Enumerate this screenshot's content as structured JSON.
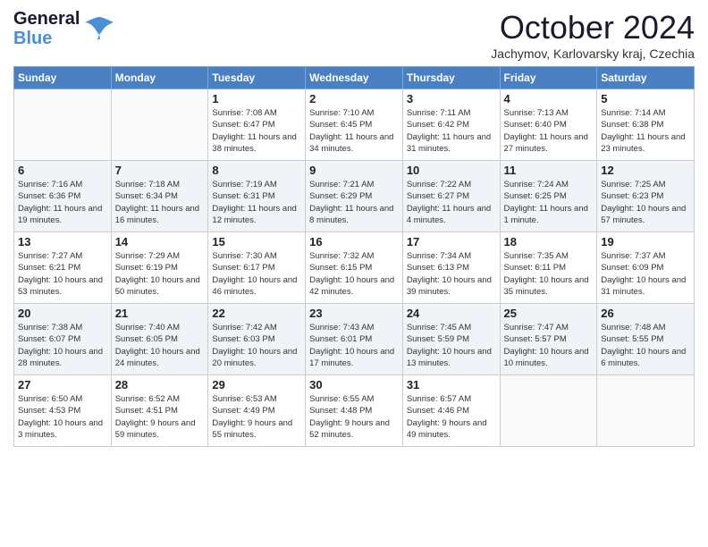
{
  "header": {
    "logo_line1": "General",
    "logo_line2": "Blue",
    "month": "October 2024",
    "location": "Jachymov, Karlovarsky kraj, Czechia"
  },
  "weekdays": [
    "Sunday",
    "Monday",
    "Tuesday",
    "Wednesday",
    "Thursday",
    "Friday",
    "Saturday"
  ],
  "weeks": [
    [
      {
        "day": "",
        "info": ""
      },
      {
        "day": "",
        "info": ""
      },
      {
        "day": "1",
        "info": "Sunrise: 7:08 AM\nSunset: 6:47 PM\nDaylight: 11 hours and 38 minutes."
      },
      {
        "day": "2",
        "info": "Sunrise: 7:10 AM\nSunset: 6:45 PM\nDaylight: 11 hours and 34 minutes."
      },
      {
        "day": "3",
        "info": "Sunrise: 7:11 AM\nSunset: 6:42 PM\nDaylight: 11 hours and 31 minutes."
      },
      {
        "day": "4",
        "info": "Sunrise: 7:13 AM\nSunset: 6:40 PM\nDaylight: 11 hours and 27 minutes."
      },
      {
        "day": "5",
        "info": "Sunrise: 7:14 AM\nSunset: 6:38 PM\nDaylight: 11 hours and 23 minutes."
      }
    ],
    [
      {
        "day": "6",
        "info": "Sunrise: 7:16 AM\nSunset: 6:36 PM\nDaylight: 11 hours and 19 minutes."
      },
      {
        "day": "7",
        "info": "Sunrise: 7:18 AM\nSunset: 6:34 PM\nDaylight: 11 hours and 16 minutes."
      },
      {
        "day": "8",
        "info": "Sunrise: 7:19 AM\nSunset: 6:31 PM\nDaylight: 11 hours and 12 minutes."
      },
      {
        "day": "9",
        "info": "Sunrise: 7:21 AM\nSunset: 6:29 PM\nDaylight: 11 hours and 8 minutes."
      },
      {
        "day": "10",
        "info": "Sunrise: 7:22 AM\nSunset: 6:27 PM\nDaylight: 11 hours and 4 minutes."
      },
      {
        "day": "11",
        "info": "Sunrise: 7:24 AM\nSunset: 6:25 PM\nDaylight: 11 hours and 1 minute."
      },
      {
        "day": "12",
        "info": "Sunrise: 7:25 AM\nSunset: 6:23 PM\nDaylight: 10 hours and 57 minutes."
      }
    ],
    [
      {
        "day": "13",
        "info": "Sunrise: 7:27 AM\nSunset: 6:21 PM\nDaylight: 10 hours and 53 minutes."
      },
      {
        "day": "14",
        "info": "Sunrise: 7:29 AM\nSunset: 6:19 PM\nDaylight: 10 hours and 50 minutes."
      },
      {
        "day": "15",
        "info": "Sunrise: 7:30 AM\nSunset: 6:17 PM\nDaylight: 10 hours and 46 minutes."
      },
      {
        "day": "16",
        "info": "Sunrise: 7:32 AM\nSunset: 6:15 PM\nDaylight: 10 hours and 42 minutes."
      },
      {
        "day": "17",
        "info": "Sunrise: 7:34 AM\nSunset: 6:13 PM\nDaylight: 10 hours and 39 minutes."
      },
      {
        "day": "18",
        "info": "Sunrise: 7:35 AM\nSunset: 6:11 PM\nDaylight: 10 hours and 35 minutes."
      },
      {
        "day": "19",
        "info": "Sunrise: 7:37 AM\nSunset: 6:09 PM\nDaylight: 10 hours and 31 minutes."
      }
    ],
    [
      {
        "day": "20",
        "info": "Sunrise: 7:38 AM\nSunset: 6:07 PM\nDaylight: 10 hours and 28 minutes."
      },
      {
        "day": "21",
        "info": "Sunrise: 7:40 AM\nSunset: 6:05 PM\nDaylight: 10 hours and 24 minutes."
      },
      {
        "day": "22",
        "info": "Sunrise: 7:42 AM\nSunset: 6:03 PM\nDaylight: 10 hours and 20 minutes."
      },
      {
        "day": "23",
        "info": "Sunrise: 7:43 AM\nSunset: 6:01 PM\nDaylight: 10 hours and 17 minutes."
      },
      {
        "day": "24",
        "info": "Sunrise: 7:45 AM\nSunset: 5:59 PM\nDaylight: 10 hours and 13 minutes."
      },
      {
        "day": "25",
        "info": "Sunrise: 7:47 AM\nSunset: 5:57 PM\nDaylight: 10 hours and 10 minutes."
      },
      {
        "day": "26",
        "info": "Sunrise: 7:48 AM\nSunset: 5:55 PM\nDaylight: 10 hours and 6 minutes."
      }
    ],
    [
      {
        "day": "27",
        "info": "Sunrise: 6:50 AM\nSunset: 4:53 PM\nDaylight: 10 hours and 3 minutes."
      },
      {
        "day": "28",
        "info": "Sunrise: 6:52 AM\nSunset: 4:51 PM\nDaylight: 9 hours and 59 minutes."
      },
      {
        "day": "29",
        "info": "Sunrise: 6:53 AM\nSunset: 4:49 PM\nDaylight: 9 hours and 55 minutes."
      },
      {
        "day": "30",
        "info": "Sunrise: 6:55 AM\nSunset: 4:48 PM\nDaylight: 9 hours and 52 minutes."
      },
      {
        "day": "31",
        "info": "Sunrise: 6:57 AM\nSunset: 4:46 PM\nDaylight: 9 hours and 49 minutes."
      },
      {
        "day": "",
        "info": ""
      },
      {
        "day": "",
        "info": ""
      }
    ]
  ]
}
